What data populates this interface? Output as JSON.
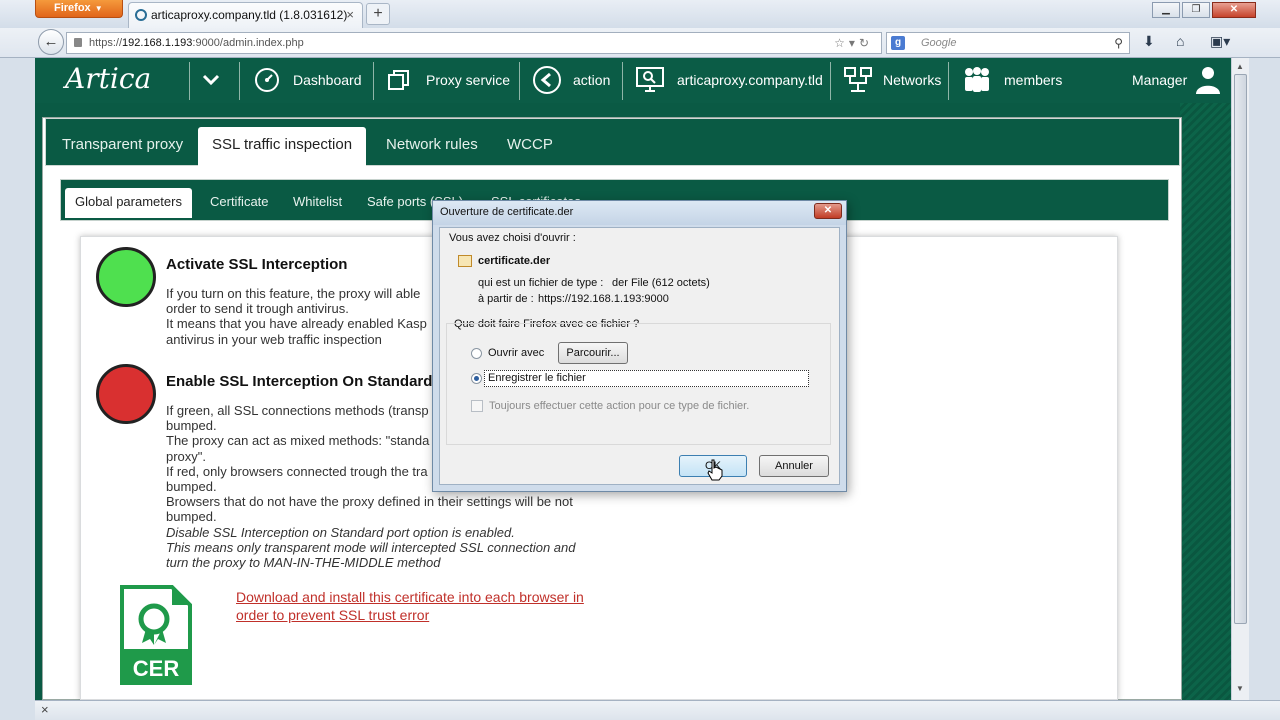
{
  "browser": {
    "menu_button": "Firefox",
    "tab_title": "articaproxy.company.tld (1.8.031612)",
    "url_prefix": "https://",
    "url_host": "192.168.1.193",
    "url_rest": ":9000/admin.index.php",
    "search_placeholder": "Google",
    "status_close": "×"
  },
  "header": {
    "logo": "Artica",
    "items": [
      {
        "label": "Dashboard"
      },
      {
        "label": "Proxy service"
      },
      {
        "label": "action"
      },
      {
        "label": "articaproxy.company.tld"
      },
      {
        "label": "Networks"
      },
      {
        "label": "members"
      },
      {
        "label": "Manager"
      }
    ]
  },
  "tabs": [
    "Transparent proxy",
    "SSL traffic inspection",
    "Network rules",
    "WCCP"
  ],
  "subtabs": [
    "Global parameters",
    "Certificate",
    "Whitelist",
    "Safe ports (SSL)",
    "SSL certificates"
  ],
  "sections": {
    "ssl": {
      "title": "Activate SSL Interception",
      "lines": [
        "If you turn on this feature, the proxy will able",
        "order to send it trough antivirus.",
        "It means that you have already enabled Kasp",
        "antivirus in your web traffic inspection"
      ]
    },
    "standard": {
      "title": "Enable SSL Interception On Standard",
      "lines": [
        "If green, all SSL connections methods (transp",
        "bumped.",
        "The proxy can act as mixed methods: \"standa",
        "proxy\".",
        "If red, only browsers connected trough the tra",
        "bumped.",
        "Browsers that do not have the proxy defined in their settings will be not",
        "bumped."
      ],
      "italic_lines": [
        "Disable SSL Interception on Standard port option is enabled.",
        "This means only transparent mode will intercepted SSL connection and",
        "turn the proxy to MAN-IN-THE-MIDDLE method"
      ]
    }
  },
  "certificate": {
    "icon_text": "CER",
    "link_line1": "Download and install this certificate into each browser in",
    "link_line2": "order to prevent SSL trust error"
  },
  "dialog": {
    "title": "Ouverture de certificate.der",
    "intro": "Vous avez choisi d'ouvrir :",
    "filename": "certificate.der",
    "type_label": "qui est un fichier de type :",
    "type_value": "der File (612 octets)",
    "from_label": "à partir de :",
    "from_value": "https://192.168.1.193:9000",
    "question": "Que doit faire Firefox avec ce fichier ?",
    "open_with": "Ouvrir avec",
    "browse": "Parcourir...",
    "save": "Enregistrer le fichier",
    "always": "Toujours effectuer cette action pour ce type de fichier.",
    "ok": "OK",
    "cancel": "Annuler",
    "selected_option": "save"
  },
  "colors": {
    "header_green": "#0b5c46",
    "status_on": "#4fe04f",
    "status_off": "#d93030",
    "link": "#c0302a"
  }
}
